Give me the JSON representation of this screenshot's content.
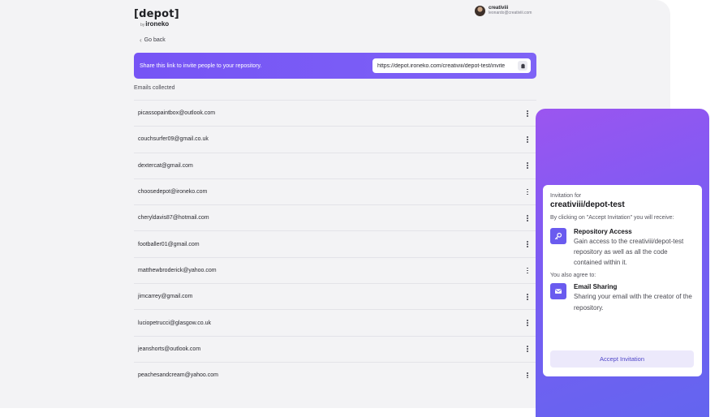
{
  "logo": {
    "main": "[depot]",
    "by": "by",
    "sub": "ironeko"
  },
  "user": {
    "name": "creativiii",
    "email": "leonardo@creativiii.com"
  },
  "nav": {
    "back_label": "Go back"
  },
  "share": {
    "text": "Share this link to invite people to your repository.",
    "link": "https://depot.ironeko.com/creativiii/depot-test/invite",
    "copy_icon": "clipboard-icon"
  },
  "emails": {
    "label": "Emails collected",
    "items": [
      "picassopaintbox@outlook.com",
      "couchsurfer09@gmail.co.uk",
      "dextercat@gmail.com",
      "choosedepot@ironeko.com",
      "cheryldavis87@hotmail.com",
      "footballer01@gmail.com",
      "matthewbroderick@yahoo.com",
      "jimcarrey@gmail.com",
      "luciopetrucci@glasgow.co.uk",
      "jeanshorts@outlook.com",
      "peachesandcream@yahoo.com"
    ]
  },
  "invitation": {
    "for_label": "Invitation for",
    "repo": "creativiii/depot-test",
    "intro": "By clicking on \"Accept Invitation\" you will receive:",
    "access_title": "Repository Access",
    "access_desc": "Gain access to the creativiii/depot-test repository as well as all the code contained within it.",
    "also_label": "You also agree to:",
    "sharing_title": "Email Sharing",
    "sharing_desc": "Sharing your email with the creator of the repository.",
    "accept_label": "Accept Invitation"
  },
  "colors": {
    "accent": "#7654f5",
    "panel_start": "#9b55f0",
    "panel_end": "#6365ef",
    "icon_bg": "#6a5bef"
  }
}
